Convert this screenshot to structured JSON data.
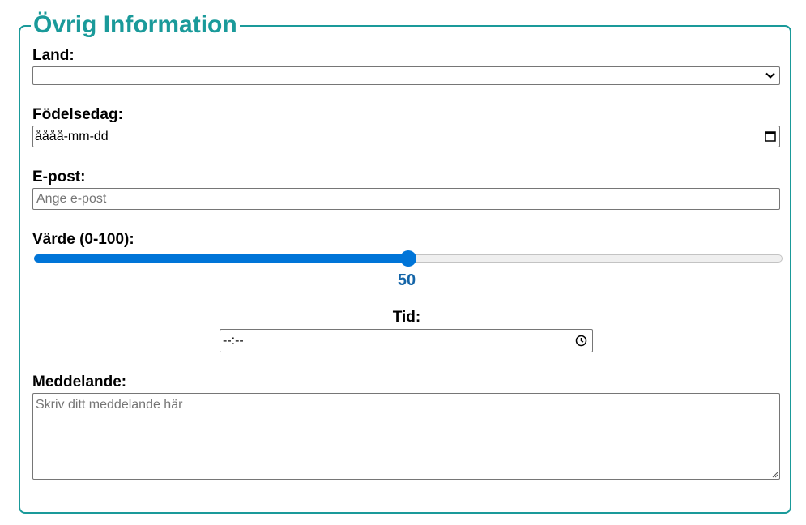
{
  "section": {
    "title": "Övrig Information"
  },
  "country": {
    "label": "Land:",
    "value": ""
  },
  "birthdate": {
    "label": "Födelsedag:",
    "value": "åååå-mm-dd"
  },
  "email": {
    "label": "E-post:",
    "placeholder": "Ange e-post"
  },
  "value_slider": {
    "label": "Värde (0-100):",
    "min": 0,
    "max": 100,
    "value": 50,
    "display": "50"
  },
  "time": {
    "label": "Tid:",
    "value": "--:--"
  },
  "message": {
    "label": "Meddelande:",
    "placeholder": "Skriv ditt meddelande här"
  },
  "icons": {
    "select": "chevron-down-icon",
    "date": "calendar-icon",
    "time": "clock-icon",
    "resize": "resize-grip-icon"
  },
  "colors": {
    "accent": "#1a9a9a",
    "slider": "#0075d8",
    "slider_value": "#1465a8"
  }
}
